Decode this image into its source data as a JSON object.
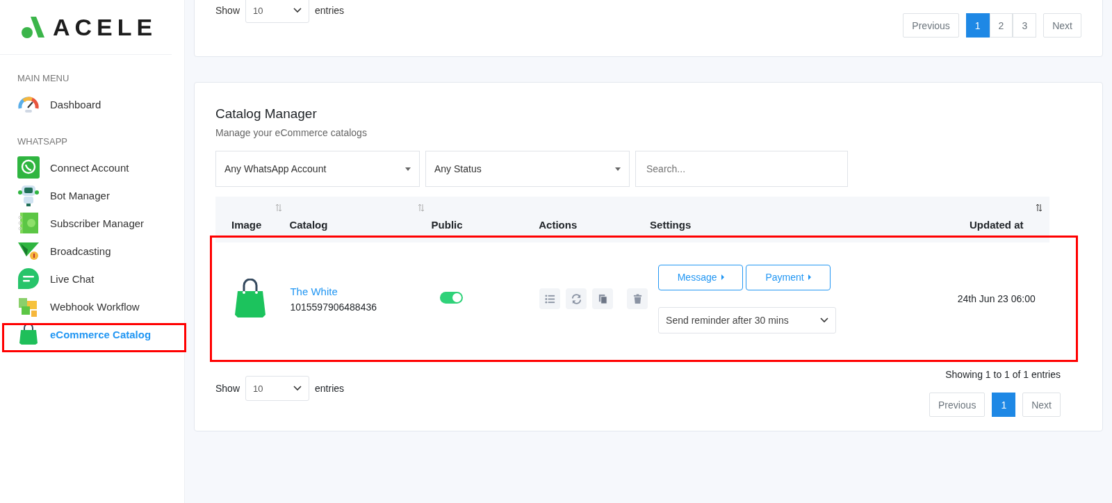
{
  "sidebar": {
    "logo": "ACELE",
    "sections": [
      {
        "heading": "MAIN MENU",
        "items": [
          {
            "label": "Dashboard",
            "kind": "dashboard",
            "selected": false,
            "highlighted": false
          }
        ]
      },
      {
        "heading": "WHATSAPP",
        "items": [
          {
            "label": "Connect Account",
            "kind": "whatsapp",
            "selected": false,
            "highlighted": false
          },
          {
            "label": "Bot Manager",
            "kind": "bot",
            "selected": false,
            "highlighted": false
          },
          {
            "label": "Subscriber Manager",
            "kind": "contacts",
            "selected": false,
            "highlighted": false
          },
          {
            "label": "Broadcasting",
            "kind": "broadcast",
            "selected": false,
            "highlighted": false
          },
          {
            "label": "Live Chat",
            "kind": "chat",
            "selected": false,
            "highlighted": false
          },
          {
            "label": "Webhook Workflow",
            "kind": "puzzle",
            "selected": false,
            "highlighted": false
          },
          {
            "label": "eCommerce Catalog",
            "kind": "bag",
            "selected": true,
            "highlighted": true
          }
        ]
      }
    ]
  },
  "top_card": {
    "length_label": "Show",
    "length_value": "10",
    "length_suffix": "entries",
    "pagination": [
      {
        "label": "Previous",
        "selected": false
      },
      {
        "label": "1",
        "selected": true
      },
      {
        "label": "2",
        "selected": false
      },
      {
        "label": "3",
        "selected": false
      },
      {
        "label": "Next",
        "selected": false
      }
    ]
  },
  "catalog_manager": {
    "title": "Catalog Manager",
    "subtitle": "Manage your eCommerce catalogs",
    "filters": {
      "account": "Any WhatsApp Account",
      "status": "Any Status",
      "search_placeholder": "Search..."
    },
    "table": {
      "columns": [
        {
          "label": "Image",
          "sortable": true
        },
        {
          "label": "Catalog",
          "sortable": true
        },
        {
          "label": "Public",
          "sortable": false
        },
        {
          "label": "Actions",
          "sortable": false
        },
        {
          "label": "Settings",
          "sortable": false
        },
        {
          "label": "Updated at",
          "sortable": true
        }
      ],
      "rows": [
        {
          "highlighted": true,
          "name": "The White",
          "catalog_id": "1015597906488436",
          "public": true,
          "buttons": [
            "Message",
            "Payment"
          ],
          "reminder": "Send reminder after 30 mins",
          "updated_at": "24th Jun 23 06:00"
        }
      ]
    },
    "length_label": "Show",
    "length_value": "10",
    "length_suffix": "entries",
    "info": "Showing 1 to 1 of 1 entries",
    "pagination": [
      {
        "label": "Previous",
        "selected": false
      },
      {
        "label": "1",
        "selected": true
      },
      {
        "label": "Next",
        "selected": false
      }
    ]
  }
}
